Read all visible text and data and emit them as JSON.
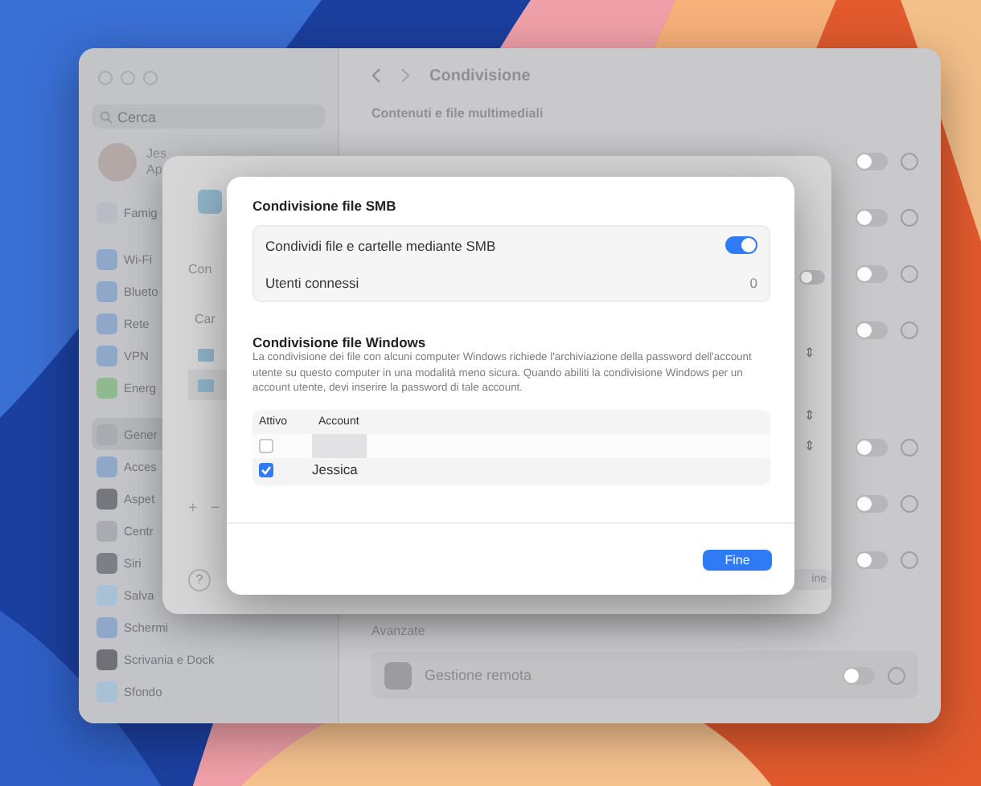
{
  "settings_window": {
    "title": "Condivisione",
    "search": {
      "placeholder": "Cerca"
    },
    "account": {
      "name": "Jes",
      "subtitle": "Ap"
    },
    "sidebar_groups": [
      [
        {
          "label": "Famig",
          "color": "#b9bcc4",
          "selected": false
        }
      ],
      [
        {
          "label": "Wi-Fi",
          "color": "#8fa7c9",
          "selected": false
        },
        {
          "label": "Blueto",
          "color": "#8fa7c9",
          "selected": false
        },
        {
          "label": "Rete",
          "color": "#8fa7c9",
          "selected": false
        },
        {
          "label": "VPN",
          "color": "#8fa7c9",
          "selected": false
        },
        {
          "label": "Energ",
          "color": "#8fb98f",
          "selected": false
        }
      ],
      [
        {
          "label": "Gener",
          "color": "#a9abb0",
          "selected": true
        },
        {
          "label": "Acces",
          "color": "#8fa7c9",
          "selected": false
        },
        {
          "label": "Aspet",
          "color": "#75777c",
          "selected": false
        },
        {
          "label": "Centr",
          "color": "#a9abb0",
          "selected": false
        },
        {
          "label": "Siri",
          "color": "#7c7f86",
          "selected": false
        },
        {
          "label": "Salva",
          "color": "#a8c1d6",
          "selected": false
        },
        {
          "label": "Schermi",
          "color": "#8fa7c9",
          "selected": false
        },
        {
          "label": "Scrivania e Dock",
          "color": "#6f7176",
          "selected": false
        },
        {
          "label": "Sfondo",
          "color": "#a8c1d6",
          "selected": false
        }
      ]
    ],
    "section": "Contenuti e file multimediali",
    "toggle_groups": [
      [
        {
          "on": false
        },
        {
          "on": false
        },
        {
          "on": false
        },
        {
          "on": false
        }
      ],
      [
        {
          "on": false
        },
        {
          "on": false
        },
        {
          "on": false
        }
      ]
    ],
    "advanced_heading": "Avanzate",
    "remote": {
      "label": "Gestione remota",
      "on": false
    }
  },
  "sheet": {
    "labels": [
      "Con",
      "Car"
    ],
    "toggle": {
      "on": false
    },
    "steppers": [
      "⇕",
      "⇕",
      "⇕"
    ],
    "add": "+",
    "remove": "−",
    "help": "?",
    "done_button": "ine"
  },
  "dialog": {
    "title": "Condivisione file SMB",
    "rows": [
      {
        "kind": "toggle",
        "label": "Condividi file e cartelle mediante SMB",
        "on": true
      },
      {
        "kind": "value",
        "label": "Utenti connessi",
        "value": "0"
      }
    ],
    "windows_heading": "Condivisione file Windows",
    "windows_text": "La condivisione dei file con alcuni computer Windows richiede l'archiviazione della password dell'account utente su questo computer in una modalità meno sicura. Quando abiliti la condivisione Windows per un account utente, devi inserire la password di tale account.",
    "table": {
      "columns": [
        "Attivo",
        "Account"
      ],
      "rows": [
        {
          "checked": false,
          "redacted": true
        },
        {
          "checked": true,
          "redacted": false,
          "account": "Jessica"
        }
      ]
    },
    "done_button": "Fine"
  }
}
